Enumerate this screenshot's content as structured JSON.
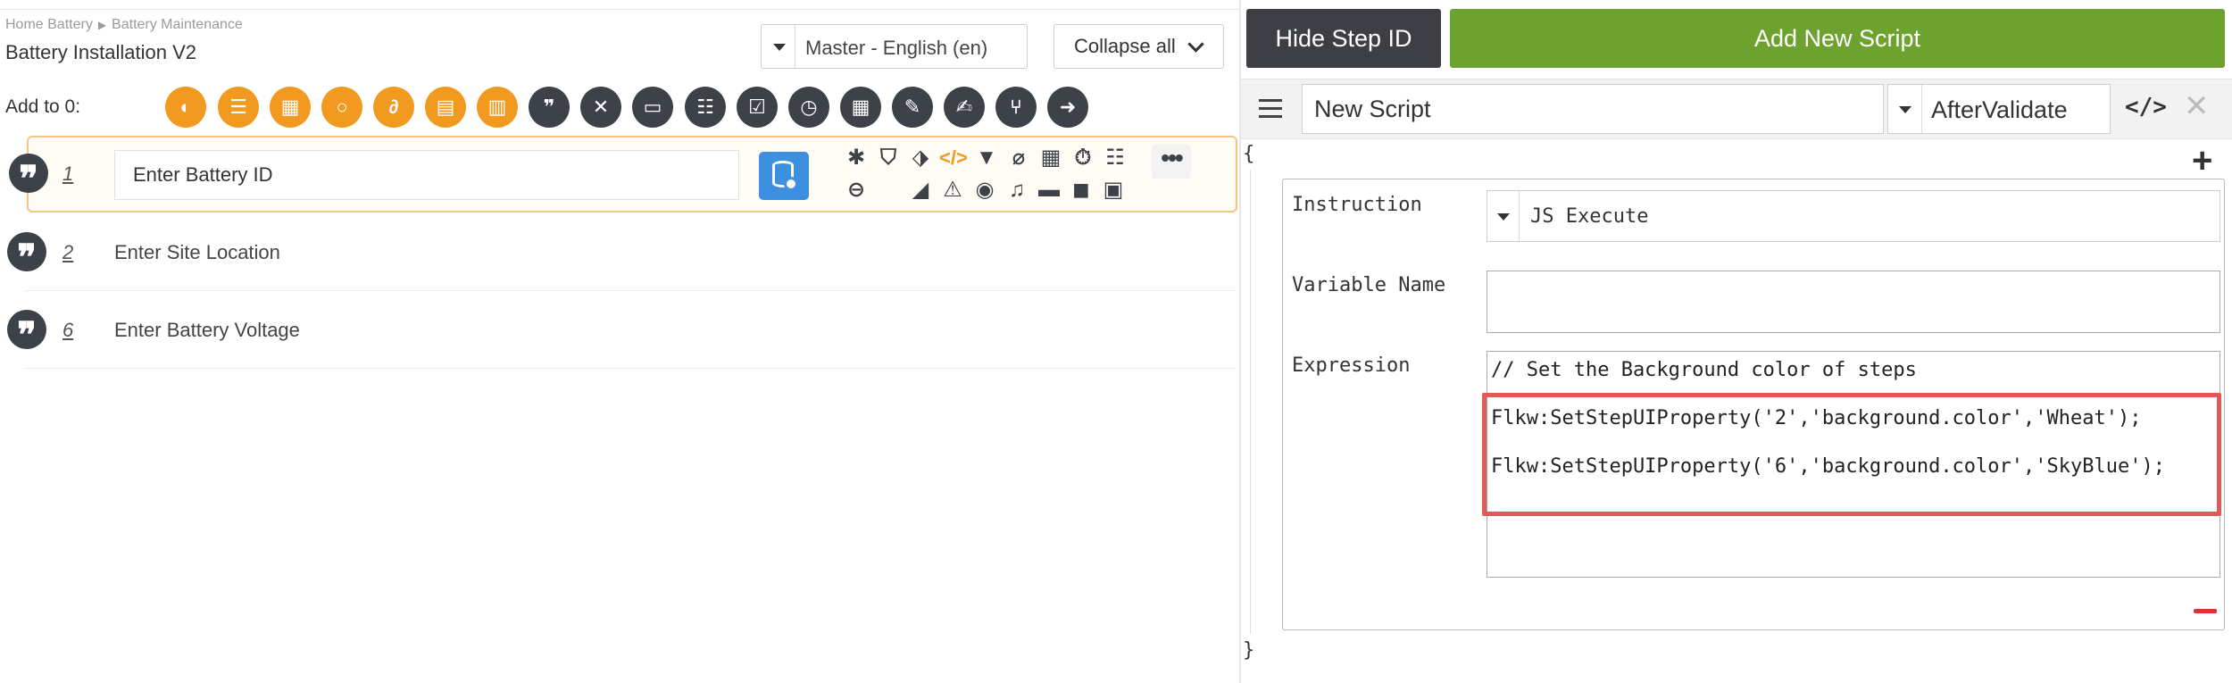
{
  "breadcrumb": {
    "items": [
      "Home Battery",
      "Battery Maintenance"
    ],
    "separator": "▶"
  },
  "page_title": "Battery Installation V2",
  "language_select": {
    "value": "Master - English (en)"
  },
  "collapse_button": {
    "label": "Collapse all"
  },
  "add_to": {
    "label": "Add to 0:"
  },
  "toolbar_tools": [
    {
      "icon": "crescent-icon",
      "color": "#f29a1f"
    },
    {
      "icon": "list-icon",
      "color": "#f29a1f"
    },
    {
      "icon": "grid-table-icon",
      "color": "#f29a1f"
    },
    {
      "icon": "circle-icon",
      "color": "#f29a1f"
    },
    {
      "icon": "hook-icon",
      "color": "#f29a1f"
    },
    {
      "icon": "clipboard-icon",
      "color": "#f29a1f"
    },
    {
      "icon": "film-icon",
      "color": "#f29a1f"
    },
    {
      "icon": "quote-icon",
      "color": "#3d4148"
    },
    {
      "icon": "check-x-icon",
      "color": "#3d4148"
    },
    {
      "icon": "input-box-icon",
      "color": "#3d4148"
    },
    {
      "icon": "checklist-icon",
      "color": "#3d4148"
    },
    {
      "icon": "checkbox-icon",
      "color": "#3d4148"
    },
    {
      "icon": "clock-icon",
      "color": "#3d4148"
    },
    {
      "icon": "calculator-icon",
      "color": "#3d4148"
    },
    {
      "icon": "tools-icon",
      "color": "#3d4148"
    },
    {
      "icon": "edit-icon",
      "color": "#3d4148"
    },
    {
      "icon": "branch-icon",
      "color": "#3d4148"
    },
    {
      "icon": "arrow-right-icon",
      "color": "#3d4148"
    }
  ],
  "steps": [
    {
      "number": "1",
      "text": "Enter Battery ID",
      "active": true
    },
    {
      "number": "2",
      "text": "Enter Site Location",
      "active": false
    },
    {
      "number": "6",
      "text": "Enter Battery Voltage",
      "active": false
    }
  ],
  "step_actions_row1": [
    "asterisk-icon",
    "shield-icon",
    "tags-icon",
    "code-icon",
    "filter-icon",
    "paperclip-icon",
    "grid-icon",
    "stopwatch-icon",
    "list-grid-icon"
  ],
  "step_actions_row2": [
    "minus-circle-icon",
    "ruler-icon",
    "warning-icon",
    "camera-icon",
    "microphone-icon",
    "comment-icon",
    "video-icon",
    "id-card-icon"
  ],
  "right": {
    "hide_step_button": "Hide Step ID",
    "add_script_button": "Add New Script",
    "script_name": "New Script",
    "script_event": "AfterValidate",
    "open_brace": "{",
    "close_brace": "}",
    "instruction_label": "Instruction",
    "instruction_value": "JS Execute",
    "variable_label": "Variable Name",
    "variable_value": "",
    "expression_label": "Expression",
    "expression_lines": [
      "// Set the Background color of steps",
      "Flkw:SetStepUIProperty('2','background.color','Wheat');",
      "Flkw:SetStepUIProperty('6','background.color','SkyBlue');"
    ]
  },
  "colors": {
    "orange": "#f29a1f",
    "dark": "#3d4148",
    "green": "#6ea22f",
    "highlight_red": "#e05a5a",
    "db_blue": "#3d8fe0"
  }
}
